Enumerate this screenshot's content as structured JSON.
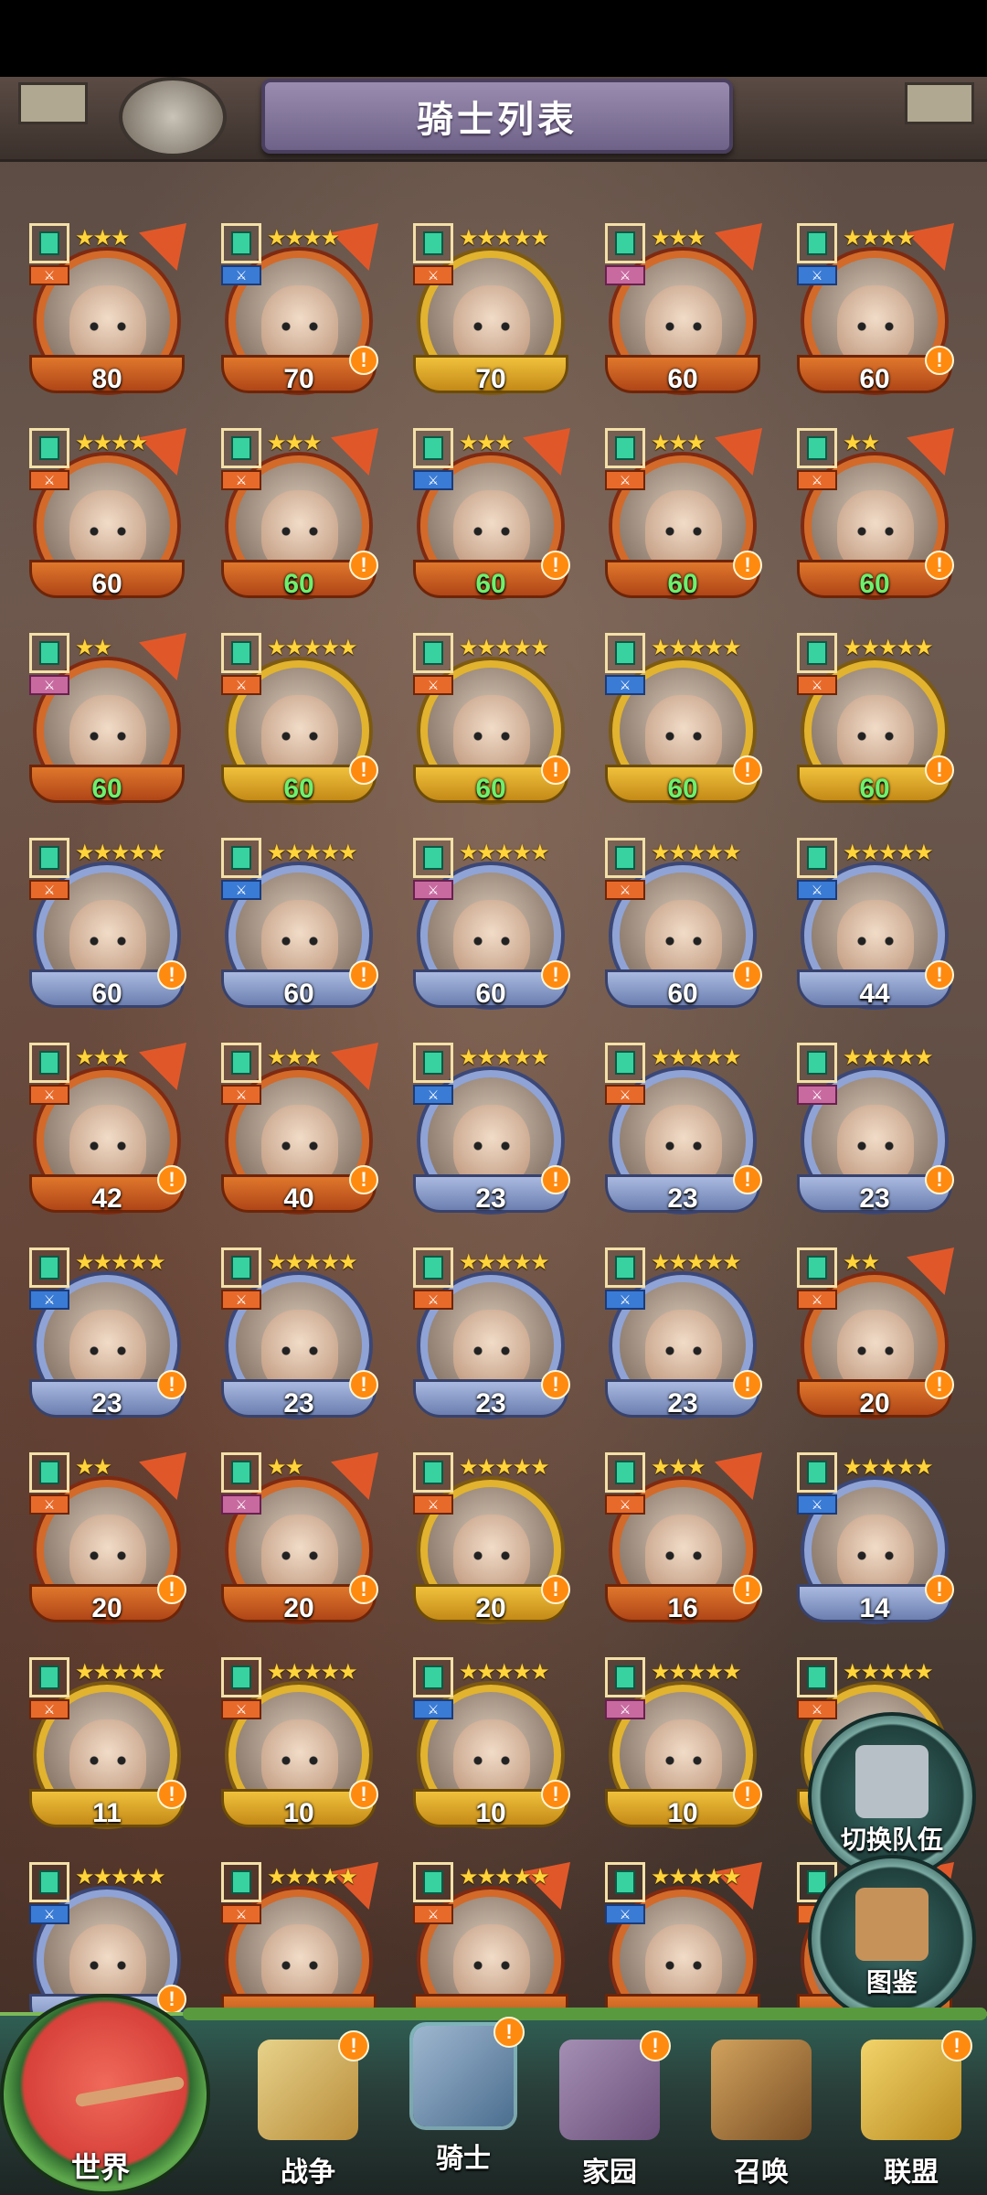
{
  "header": {
    "title": "骑士列表"
  },
  "colors": {
    "alert": "#ff8a10",
    "level_green": "#6ef06e",
    "nav_bg": "#2a3f3a"
  },
  "knights": [
    {
      "level": "80",
      "stars": "★★★",
      "tier": "red",
      "alert": false,
      "green": false
    },
    {
      "level": "70",
      "stars": "★★★★",
      "tier": "red",
      "alert": true,
      "green": false
    },
    {
      "level": "70",
      "stars": "★★★★★",
      "tier": "gold",
      "alert": false,
      "green": false
    },
    {
      "level": "60",
      "stars": "★★★",
      "tier": "red",
      "alert": false,
      "green": false
    },
    {
      "level": "60",
      "stars": "★★★★",
      "tier": "red",
      "alert": true,
      "green": false
    },
    {
      "level": "60",
      "stars": "★★★★",
      "tier": "red",
      "alert": false,
      "green": false
    },
    {
      "level": "60",
      "stars": "★★★",
      "tier": "red",
      "alert": true,
      "green": true
    },
    {
      "level": "60",
      "stars": "★★★",
      "tier": "red",
      "alert": true,
      "green": true
    },
    {
      "level": "60",
      "stars": "★★★",
      "tier": "red",
      "alert": true,
      "green": true
    },
    {
      "level": "60",
      "stars": "★★",
      "tier": "red",
      "alert": true,
      "green": true
    },
    {
      "level": "60",
      "stars": "★★",
      "tier": "red",
      "alert": false,
      "green": true
    },
    {
      "level": "60",
      "stars": "★★★★★",
      "tier": "gold",
      "alert": true,
      "green": true
    },
    {
      "level": "60",
      "stars": "★★★★★",
      "tier": "gold",
      "alert": true,
      "green": true
    },
    {
      "level": "60",
      "stars": "★★★★★",
      "tier": "gold",
      "alert": true,
      "green": true
    },
    {
      "level": "60",
      "stars": "★★★★★",
      "tier": "gold",
      "alert": true,
      "green": true
    },
    {
      "level": "60",
      "stars": "★★★★★",
      "tier": "blue",
      "alert": true,
      "green": false
    },
    {
      "level": "60",
      "stars": "★★★★★",
      "tier": "blue",
      "alert": true,
      "green": false
    },
    {
      "level": "60",
      "stars": "★★★★★",
      "tier": "blue",
      "alert": true,
      "green": false
    },
    {
      "level": "60",
      "stars": "★★★★★",
      "tier": "blue",
      "alert": true,
      "green": false
    },
    {
      "level": "44",
      "stars": "★★★★★",
      "tier": "blue",
      "alert": true,
      "green": false
    },
    {
      "level": "42",
      "stars": "★★★",
      "tier": "red",
      "alert": true,
      "green": false
    },
    {
      "level": "40",
      "stars": "★★★",
      "tier": "red",
      "alert": true,
      "green": false
    },
    {
      "level": "23",
      "stars": "★★★★★",
      "tier": "blue",
      "alert": true,
      "green": false
    },
    {
      "level": "23",
      "stars": "★★★★★",
      "tier": "blue",
      "alert": true,
      "green": false
    },
    {
      "level": "23",
      "stars": "★★★★★",
      "tier": "blue",
      "alert": true,
      "green": false
    },
    {
      "level": "23",
      "stars": "★★★★★",
      "tier": "blue",
      "alert": true,
      "green": false
    },
    {
      "level": "23",
      "stars": "★★★★★",
      "tier": "blue",
      "alert": true,
      "green": false
    },
    {
      "level": "23",
      "stars": "★★★★★",
      "tier": "blue",
      "alert": true,
      "green": false
    },
    {
      "level": "23",
      "stars": "★★★★★",
      "tier": "blue",
      "alert": true,
      "green": false
    },
    {
      "level": "20",
      "stars": "★★",
      "tier": "red",
      "alert": true,
      "green": false
    },
    {
      "level": "20",
      "stars": "★★",
      "tier": "red",
      "alert": true,
      "green": false
    },
    {
      "level": "20",
      "stars": "★★",
      "tier": "red",
      "alert": true,
      "green": false
    },
    {
      "level": "20",
      "stars": "★★★★★",
      "tier": "gold",
      "alert": true,
      "green": false
    },
    {
      "level": "16",
      "stars": "★★★",
      "tier": "red",
      "alert": true,
      "green": false
    },
    {
      "level": "14",
      "stars": "★★★★★",
      "tier": "blue",
      "alert": true,
      "green": false
    },
    {
      "level": "11",
      "stars": "★★★★★",
      "tier": "gold",
      "alert": true,
      "green": false
    },
    {
      "level": "10",
      "stars": "★★★★★",
      "tier": "gold",
      "alert": true,
      "green": false
    },
    {
      "level": "10",
      "stars": "★★★★★",
      "tier": "gold",
      "alert": true,
      "green": false
    },
    {
      "level": "10",
      "stars": "★★★★★",
      "tier": "gold",
      "alert": true,
      "green": false
    },
    {
      "level": "",
      "stars": "★★★★★",
      "tier": "gold",
      "alert": false,
      "green": false
    },
    {
      "level": "",
      "stars": "★★★★★",
      "tier": "blue",
      "alert": true,
      "green": false
    },
    {
      "level": "",
      "stars": "★★★★★",
      "tier": "red",
      "alert": false,
      "green": false
    },
    {
      "level": "",
      "stars": "★★★★★",
      "tier": "red",
      "alert": false,
      "green": false
    },
    {
      "level": "",
      "stars": "★★★★★",
      "tier": "red",
      "alert": false,
      "green": false
    },
    {
      "level": "",
      "stars": "★★★★★",
      "tier": "red",
      "alert": false,
      "green": false
    }
  ],
  "side_buttons": {
    "switch_team": "切换队伍",
    "codex": "图鉴"
  },
  "nav": {
    "world": "世界",
    "items": [
      {
        "label": "战争",
        "badge": "!"
      },
      {
        "label": "骑士",
        "badge": "!"
      },
      {
        "label": "家园",
        "badge": "!"
      },
      {
        "label": "召唤",
        "badge": ""
      },
      {
        "label": "联盟",
        "badge": "!"
      }
    ]
  }
}
